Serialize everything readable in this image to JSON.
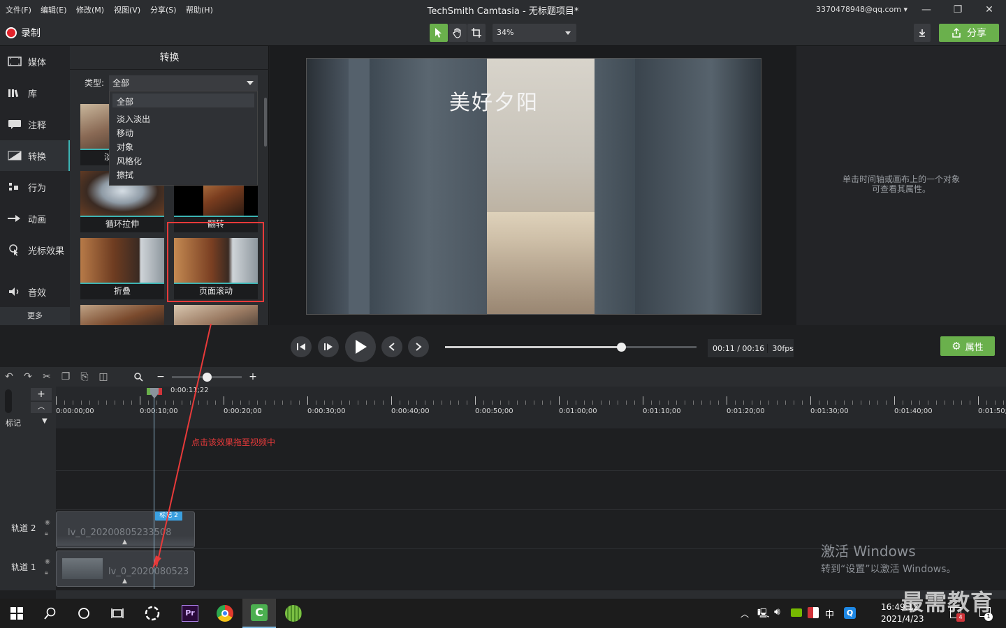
{
  "menu": {
    "items": [
      "文件(F)",
      "编辑(E)",
      "修改(M)",
      "视图(V)",
      "分享(S)",
      "帮助(H)"
    ]
  },
  "window": {
    "title": "TechSmith Camtasia - 无标题项目*",
    "account": "3370478948@qq.com"
  },
  "toolbar": {
    "record_label": "录制",
    "zoom": "34%",
    "share_label": "分享"
  },
  "sidebar": {
    "items": [
      {
        "label": "媒体",
        "icon": "media-icon"
      },
      {
        "label": "库",
        "icon": "library-icon"
      },
      {
        "label": "注释",
        "icon": "annotation-icon"
      },
      {
        "label": "转换",
        "icon": "transition-icon"
      },
      {
        "label": "行为",
        "icon": "behavior-icon"
      },
      {
        "label": "动画",
        "icon": "animation-icon"
      },
      {
        "label": "光标效果",
        "icon": "cursor-effect-icon"
      },
      {
        "label": "音效",
        "icon": "audio-icon"
      }
    ],
    "more_label": "更多",
    "active": "转换"
  },
  "panel": {
    "title": "转换",
    "type_label": "类型:",
    "type_value": "全部",
    "options": [
      "全部",
      "淡入淡出",
      "移动",
      "对象",
      "风格化",
      "擦拭"
    ],
    "thumbs": [
      "循环拉伸",
      "翻转",
      "折叠",
      "页面滚动"
    ],
    "partial_label": "淡"
  },
  "preview": {
    "title_text": "美好夕阳"
  },
  "properties": {
    "hint_line1": "单击时间轴或画布上的一个对象",
    "hint_line2": "可查看其属性。",
    "button_label": "属性"
  },
  "playback": {
    "timecode": "00:11 / 00:16",
    "fps": "30fps",
    "progress": 0.7
  },
  "timeline": {
    "playhead_time": "0:00:11;22",
    "ticks": [
      "0:00:00;00",
      "0:00:10;00",
      "0:00:20;00",
      "0:00:30;00",
      "0:00:40;00",
      "0:00:50;00",
      "0:01:00;00",
      "0:01:10;00",
      "0:01:20;00",
      "0:01:30;00",
      "0:01:40;00",
      "0:01:50;"
    ],
    "marker_label": "标记",
    "tracks": [
      {
        "name": "轨道 2",
        "clip": "lv_0_20200805233508",
        "marker": "标记 2"
      },
      {
        "name": "轨道 1",
        "clip": "lv_0_2020080523"
      }
    ]
  },
  "annotation": {
    "text": "点击该效果拖至视频中"
  },
  "activation": {
    "line1": "激活 Windows",
    "line2": "转到“设置”以激活 Windows。"
  },
  "taskbar": {
    "time": "16:49:12",
    "date": "2021/4/23",
    "ime": "中",
    "badge1": "4",
    "badge2": "1"
  },
  "watermark": "最需教育",
  "colors": {
    "accent": "#6ab04c",
    "teal": "#3cb4b4",
    "record": "#e3232b",
    "annotation": "#e83a3a"
  }
}
